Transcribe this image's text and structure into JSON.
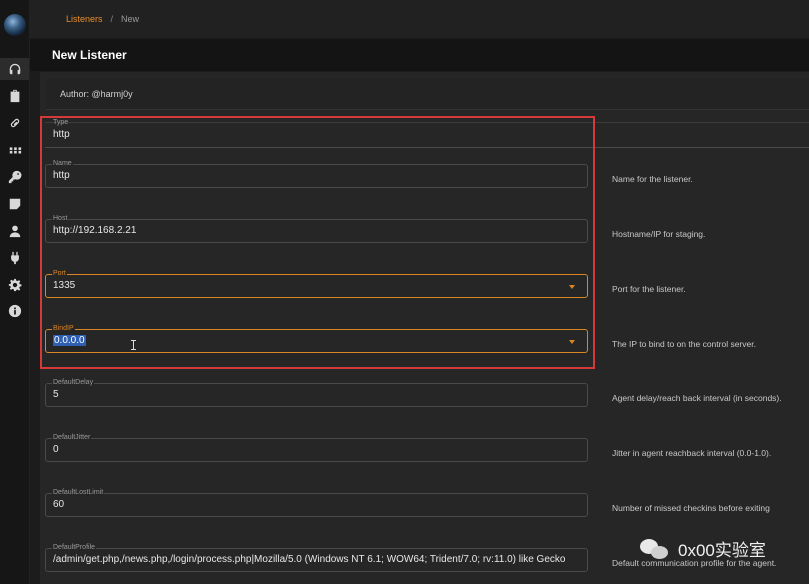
{
  "breadcrumb": {
    "parent": "Listeners",
    "separator": "/",
    "current": "New"
  },
  "page_title": "New Listener",
  "author": "Author: @harmj0y",
  "colors": {
    "accent": "#e88d2a",
    "highlight_box": "#d43a3a",
    "selection": "#2f5fb3"
  },
  "sidebar": {
    "icons": [
      "logo",
      "headphones-icon",
      "briefcase-icon",
      "link-icon",
      "grid-icon",
      "key-icon",
      "note-icon",
      "user-icon",
      "plug-icon",
      "gear-icon",
      "info-icon"
    ]
  },
  "fields": {
    "type": {
      "label": "Type",
      "value": "http"
    },
    "name": {
      "label": "Name",
      "value": "http",
      "help": "Name for the listener."
    },
    "host": {
      "label": "Host",
      "value": "http://192.168.2.21",
      "help": "Hostname/IP for staging."
    },
    "port": {
      "label": "Port",
      "value": "1335",
      "help": "Port for the listener."
    },
    "bindip": {
      "label": "BindIP",
      "value": "0.0.0.0",
      "help": "The IP to bind to on the control server."
    },
    "default_delay": {
      "label": "DefaultDelay",
      "value": "5",
      "help": "Agent delay/reach back interval (in seconds)."
    },
    "default_jitter": {
      "label": "DefaultJitter",
      "value": "0",
      "help": "Jitter in agent reachback interval (0.0-1.0)."
    },
    "default_lost_limit": {
      "label": "DefaultLostLimit",
      "value": "60",
      "help": "Number of missed checkins before exiting"
    },
    "default_profile": {
      "label": "DefaultProfile",
      "value": "/admin/get.php,/news.php,/login/process.php|Mozilla/5.0 (Windows NT 6.1; WOW64; Trident/7.0; rv:11.0) like Gecko",
      "help": "Default communication profile for the agent."
    }
  },
  "watermark": "0x00实验室"
}
